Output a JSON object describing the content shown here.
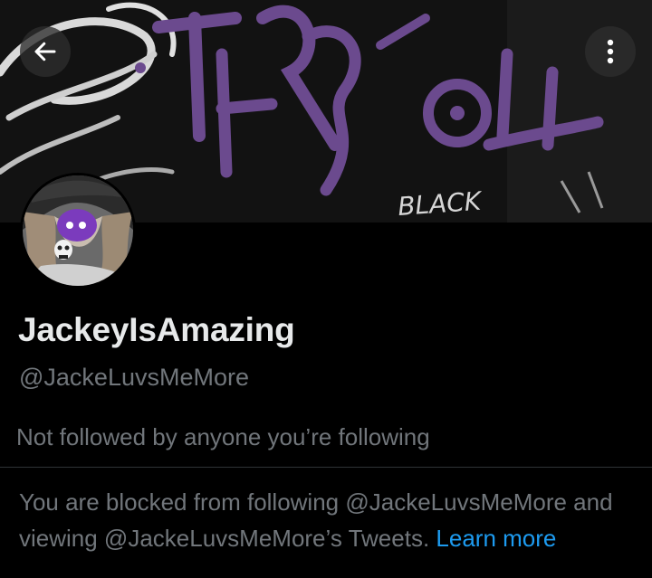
{
  "header": {
    "back_icon": "arrow-left-icon",
    "more_icon": "more-vertical-icon",
    "banner_text": "BLACK"
  },
  "profile": {
    "display_name": "JackeyIsAmazing",
    "handle": "@JackeLuvsMeMore",
    "followers_you_know": "Not followed by anyone you’re following"
  },
  "blocked": {
    "message": "You are blocked from following @JackeLuvsMeMore and viewing @JackeLuvsMeMore’s Tweets.",
    "link_label": "Learn more"
  },
  "colors": {
    "background": "#000000",
    "primary_text": "#e7e9ea",
    "secondary_text": "#71767b",
    "link": "#1d9bf0",
    "banner_graffiti": "#6b4a8e"
  }
}
